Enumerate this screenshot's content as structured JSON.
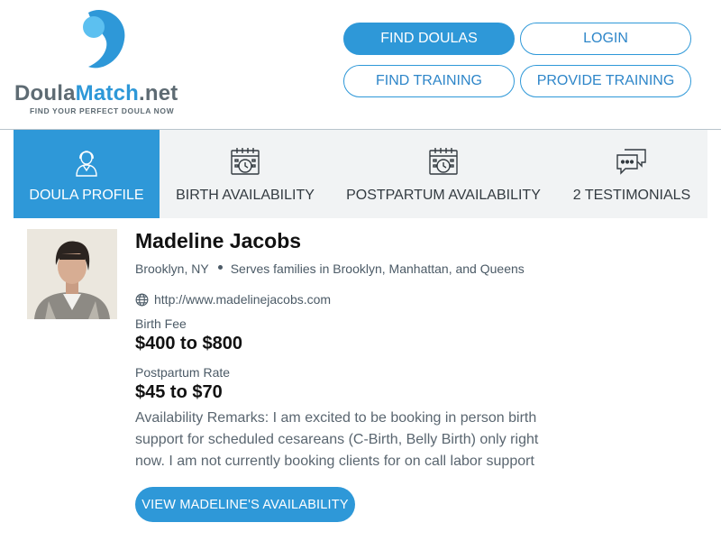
{
  "brand": {
    "name_main": "Doula",
    "name_accent": "Match",
    "name_suffix": ".net",
    "tagline": "FIND YOUR PERFECT DOULA NOW",
    "accent_color": "#2e98d8"
  },
  "nav": {
    "find_doulas": "FIND DOULAS",
    "login": "LOGIN",
    "find_training": "FIND TRAINING",
    "provide_training": "PROVIDE TRAINING"
  },
  "tabs": [
    {
      "label": "DOULA PROFILE",
      "icon": "person-icon",
      "active": true
    },
    {
      "label": "BIRTH AVAILABILITY",
      "icon": "calendar-clock-icon",
      "active": false
    },
    {
      "label": "POSTPARTUM AVAILABILITY",
      "icon": "calendar-clock-icon",
      "active": false
    },
    {
      "label": "2 TESTIMONIALS",
      "icon": "chat-bubbles-icon",
      "active": false
    }
  ],
  "profile": {
    "name": "Madeline Jacobs",
    "city": "Brooklyn, NY",
    "serves": "Serves families in Brooklyn, Manhattan, and Queens",
    "website": "http://www.madelinejacobs.com",
    "birth_fee_label": "Birth Fee",
    "birth_fee": "$400 to $800",
    "postpartum_label": "Postpartum Rate",
    "postpartum_rate": "$45 to $70",
    "remarks": "Availability Remarks: I am excited to be booking in person birth support for scheduled cesareans (C-Birth, Belly Birth) only right now. I am not currently booking clients for on call labor support",
    "availability_button": "VIEW MADELINE'S AVAILABILITY"
  }
}
